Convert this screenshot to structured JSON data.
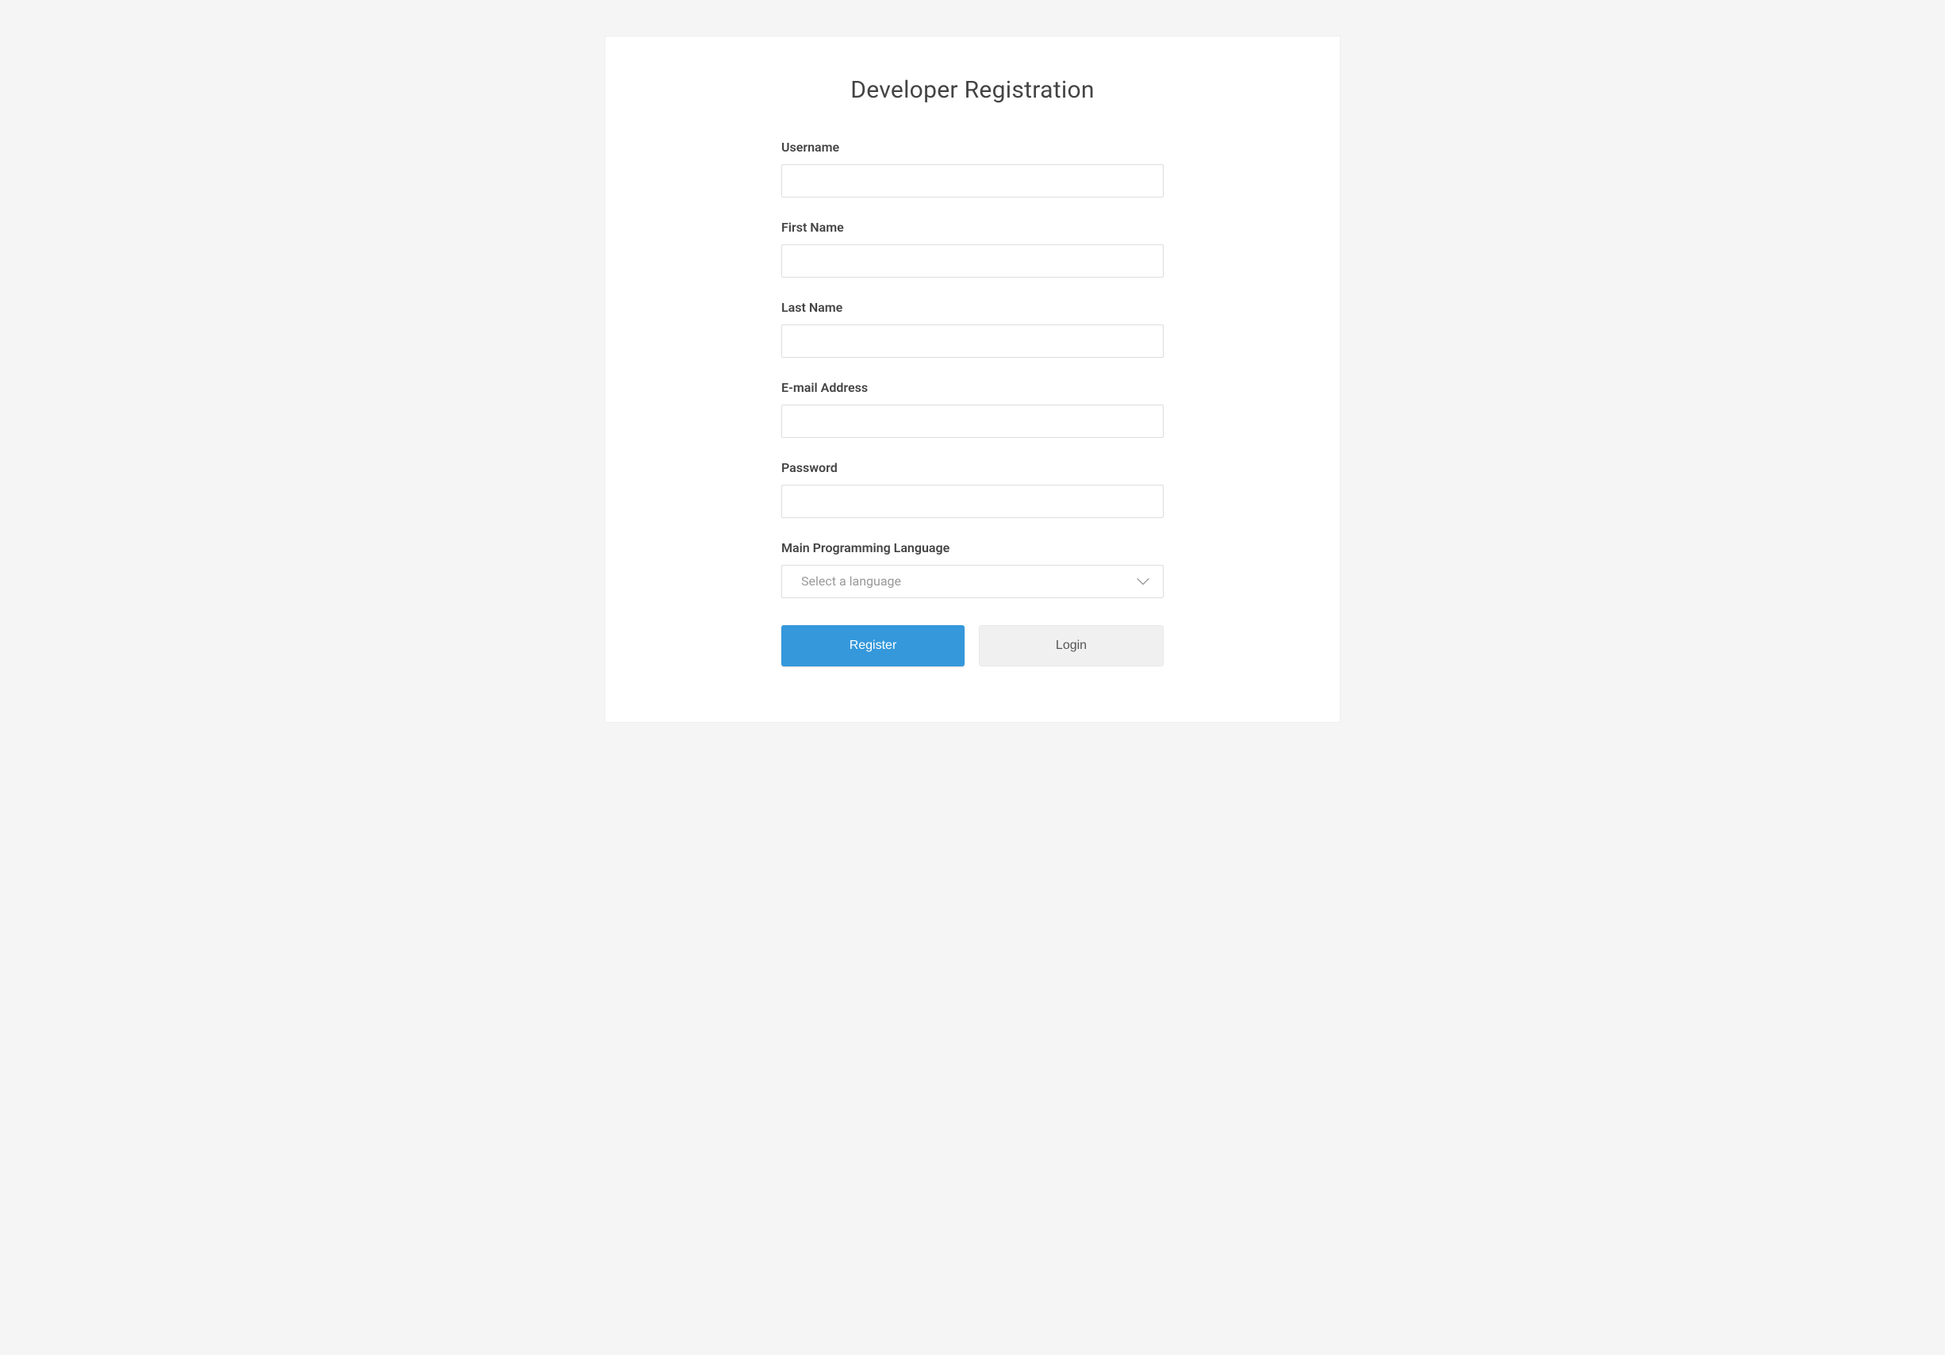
{
  "page": {
    "title": "Developer Registration"
  },
  "form": {
    "username": {
      "label": "Username",
      "value": ""
    },
    "first_name": {
      "label": "First Name",
      "value": ""
    },
    "last_name": {
      "label": "Last Name",
      "value": ""
    },
    "email": {
      "label": "E-mail Address",
      "value": ""
    },
    "password": {
      "label": "Password",
      "value": ""
    },
    "language": {
      "label": "Main Programming Language",
      "placeholder": "Select a language",
      "value": ""
    }
  },
  "buttons": {
    "register": "Register",
    "login": "Login"
  }
}
